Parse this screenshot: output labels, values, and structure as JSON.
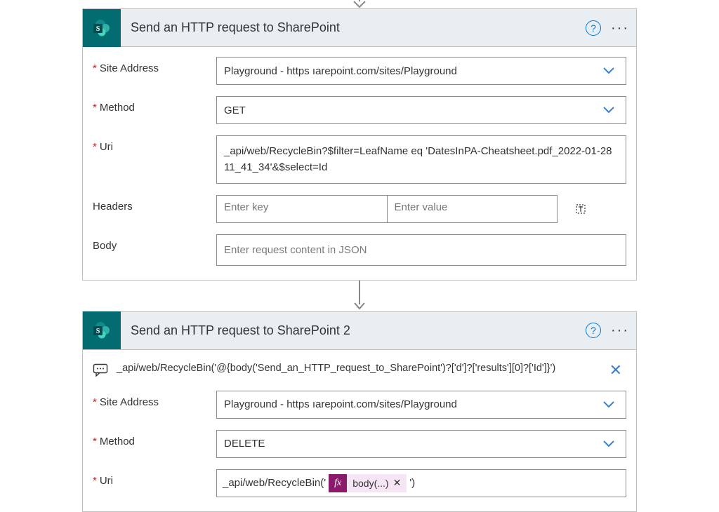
{
  "connector": {
    "arrow_color": "#8a8886"
  },
  "card1": {
    "title": "Send an HTTP request to SharePoint",
    "labels": {
      "site_address": "Site Address",
      "method": "Method",
      "uri": "Uri",
      "headers": "Headers",
      "body": "Body"
    },
    "values": {
      "site_address": "Playground - https            ıarepoint.com/sites/Playground",
      "method": "GET",
      "uri": "_api/web/RecycleBin?$filter=LeafName eq 'DatesInPA-Cheatsheet.pdf_2022-01-28 11_41_34'&$select=Id"
    },
    "placeholders": {
      "header_key": "Enter key",
      "header_value": "Enter value",
      "body": "Enter request content in JSON"
    }
  },
  "card2": {
    "title": "Send an HTTP request to SharePoint 2",
    "info_text": "_api/web/RecycleBin('@{body('Send_an_HTTP_request_to_SharePoint')?['d']?['results'][0]?['Id']}')",
    "labels": {
      "site_address": "Site Address",
      "method": "Method",
      "uri": "Uri"
    },
    "values": {
      "site_address": "Playground - https            ıarepoint.com/sites/Playground",
      "method": "DELETE",
      "uri_prefix": "_api/web/RecycleBin('",
      "uri_suffix": "')"
    },
    "fx_chip": {
      "badge": "fx",
      "label": "body(...)"
    }
  }
}
